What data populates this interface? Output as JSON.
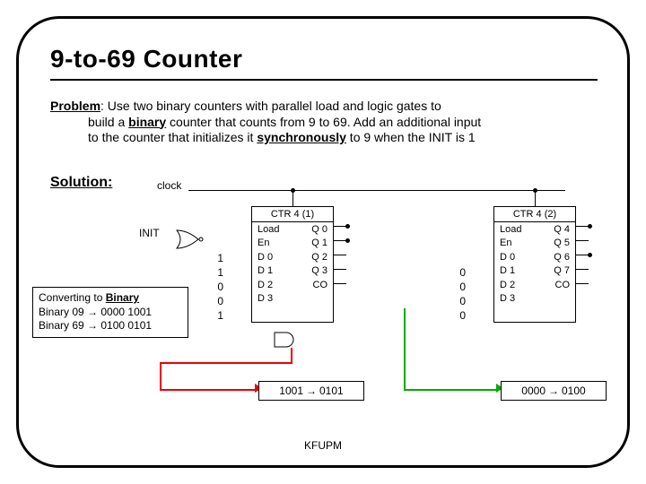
{
  "title": "9-to-69 Counter",
  "problem": {
    "label": "Problem",
    "line1_a": ": Use two binary counters with parallel load and logic gates to",
    "line2_a": "build a ",
    "line2_b": "binary",
    "line2_c": " counter that counts from 9 to 69. Add an additional input",
    "line3_a": "to the counter that initializes it ",
    "line3_b": "synchronously",
    "line3_c": " to 9 when the INIT is 1"
  },
  "solution_label": "Solution:",
  "clock_label": "clock",
  "init_label": "INIT",
  "ctr1": {
    "title": "CTR 4 (1)",
    "left": [
      "Load",
      "En",
      "D 0",
      "D 1",
      "D 2",
      "D 3"
    ],
    "right": [
      "Q 0",
      "Q 1",
      "Q 2",
      "Q 3",
      "CO",
      ""
    ]
  },
  "ctr2": {
    "title": "CTR 4 (2)",
    "left": [
      "Load",
      "En",
      "D 0",
      "D 1",
      "D 2",
      "D 3"
    ],
    "right": [
      "Q 4",
      "Q 5",
      "Q 6",
      "Q 7",
      "CO",
      ""
    ]
  },
  "bits1": [
    "1",
    "1",
    "0",
    "0",
    "1"
  ],
  "bits2": [
    "0",
    "0",
    "0",
    "0"
  ],
  "conversion": {
    "head": "Converting to ",
    "head_b": "Binary",
    "l1": "Binary 09 → 0000 1001",
    "l2": "Binary 69 → 0100 0101"
  },
  "range1_a": "1001",
  "range1_b": "0101",
  "range2_a": "0000",
  "range2_b": "0100",
  "arrow": "→",
  "footer": "KFUPM"
}
